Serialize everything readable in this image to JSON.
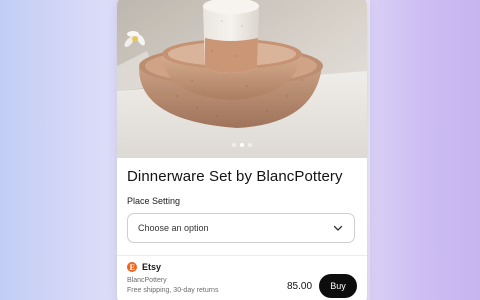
{
  "product": {
    "title": "Dinnerware Set by BlancPottery",
    "image_icon": "ceramic-bowls-photo",
    "carousel": {
      "count": 3,
      "active": 1
    }
  },
  "option": {
    "label": "Place Setting",
    "placeholder": "Choose an option"
  },
  "seller": {
    "logo_letter": "E",
    "platform": "Etsy",
    "shop": "BlancPottery",
    "shipping": "Free shipping, 30-day returns",
    "price": "85.00",
    "buy_label": "Buy"
  },
  "colors": {
    "brand": "#f1641e",
    "button": "#0d0d0d"
  }
}
